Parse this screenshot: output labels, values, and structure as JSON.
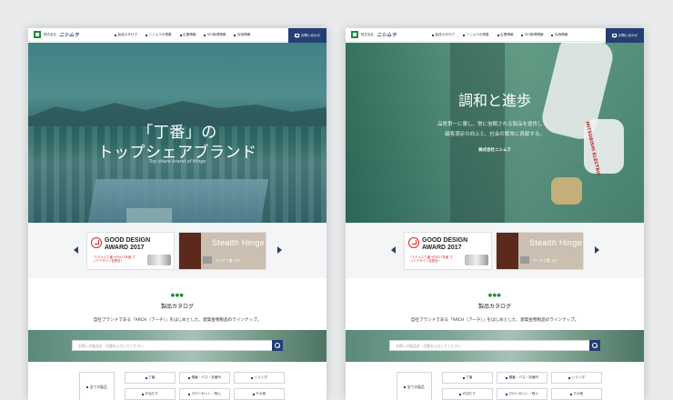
{
  "header": {
    "company_small": "株式会社",
    "company_name": "ニシムラ",
    "nav": [
      "製品カタログ",
      "ニシムラの想善",
      "企業情報",
      "ISO取得情報",
      "採用情報"
    ],
    "contact": "お問い合わせ"
  },
  "hero_left": {
    "line1": "「丁番」の",
    "line2": "トップシェアブランド",
    "sub": "Top share brand of Hinge"
  },
  "hero_right": {
    "title": "調和と進歩",
    "copy1": "品質第一に徹し、常に信頼される製品を提供して、",
    "copy2": "顧客満足の向上と、社会の繁栄に貢献する。",
    "logo": "株式会社ニシムラ",
    "robot_brand": "MITSUBISHI ELECTRIC"
  },
  "banners": {
    "gd_line1": "GOOD DESIGN",
    "gd_line2": "AWARD 2017",
    "gd_note": "\"ステルス丁番\"が2017年度 グッドデザイン賞受賞!",
    "sh_title": "Stealth Hinge",
    "sh_sub": "アーチ丁番 ステ"
  },
  "catalog": {
    "dots": "●●●",
    "title": "製品カタログ",
    "desc": "自社ブランドである「ARCH（アーチ）」をはじめとした、建築金物製品のラインナップ。",
    "search_placeholder": "お探しの製品名・品番を入力してください",
    "all_label": "全ての製品",
    "categories": [
      "丁番",
      "蝶番・バス・洗面所",
      "シリンダ",
      "戸当たり",
      "クローゼット・物入",
      "その他"
    ]
  }
}
